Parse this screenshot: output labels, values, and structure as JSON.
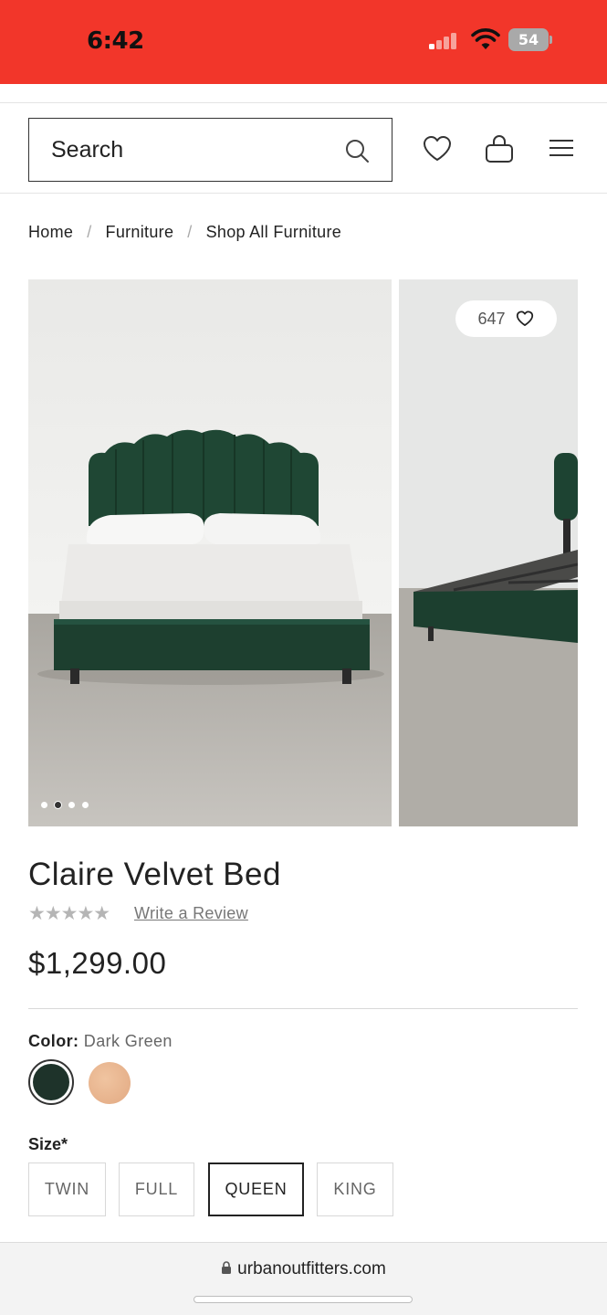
{
  "status_bar": {
    "time": "6:42",
    "battery": "54",
    "background_color": "#f2362a"
  },
  "header": {
    "search_placeholder": "Search",
    "icons": [
      "search-icon",
      "heart-icon",
      "bag-icon",
      "hamburger-menu-icon"
    ]
  },
  "breadcrumb": {
    "items": [
      "Home",
      "Furniture",
      "Shop All Furniture"
    ],
    "separator": "/"
  },
  "gallery": {
    "like_count": "647",
    "slide_count": 4,
    "active_slide": 2
  },
  "product": {
    "title": "Claire Velvet Bed",
    "rating_stars": "★★★★★",
    "review_link": "Write a Review",
    "price": "$1,299.00"
  },
  "color": {
    "label": "Color:",
    "selected": "Dark Green",
    "swatches": [
      {
        "name": "Dark Green",
        "hex": "#1e332a",
        "selected": true
      },
      {
        "name": "Peach",
        "hex": "#e8b690",
        "selected": false
      }
    ]
  },
  "size": {
    "label": "Size*",
    "options": [
      "TWIN",
      "FULL",
      "QUEEN",
      "KING"
    ],
    "selected": "QUEEN"
  },
  "browser": {
    "url": "urbanoutfitters.com"
  }
}
